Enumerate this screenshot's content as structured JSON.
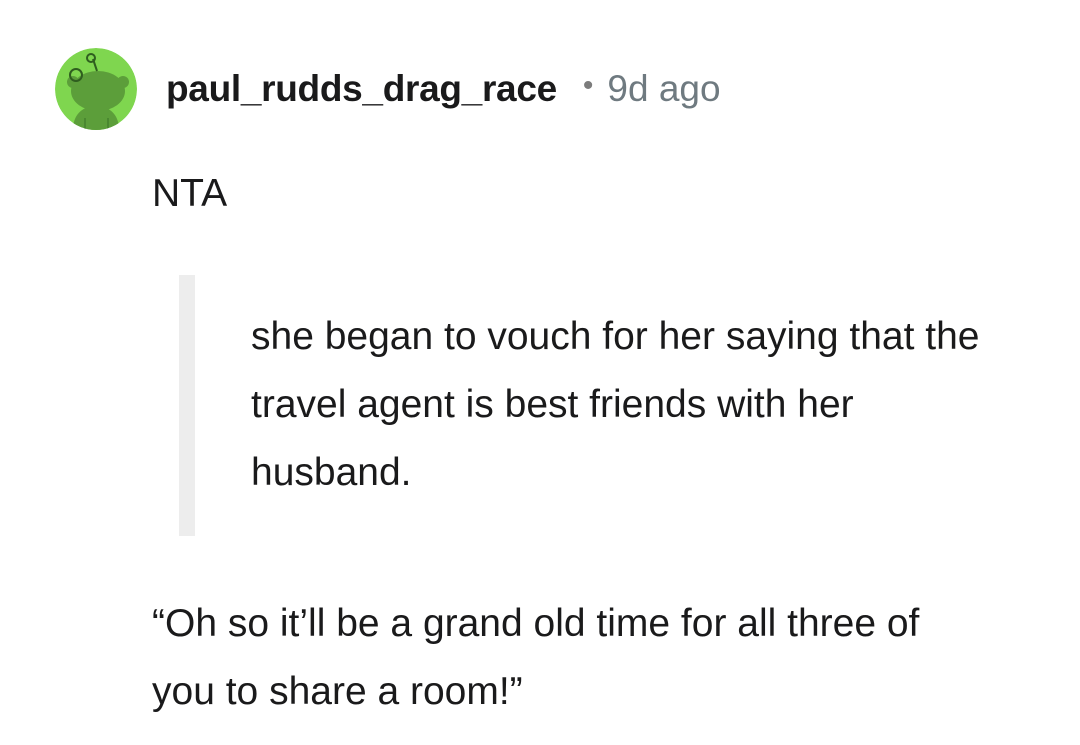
{
  "comment": {
    "author": "paul_rudds_drag_race",
    "separator": "•",
    "timestamp": "9d ago",
    "avatar_icon": "reddit-snoo-avatar",
    "avatar_color": "#7fd64f",
    "body": {
      "first_line": "NTA",
      "quote": "she began to vouch for her saying that the travel agent is best friends with her husband.",
      "reply": "“Oh so it’ll be a grand old time for all three of you to share a room!”"
    }
  },
  "colors": {
    "text": "#1a1a1b",
    "muted": "#6f7a80",
    "quote_bar": "#ededed"
  }
}
